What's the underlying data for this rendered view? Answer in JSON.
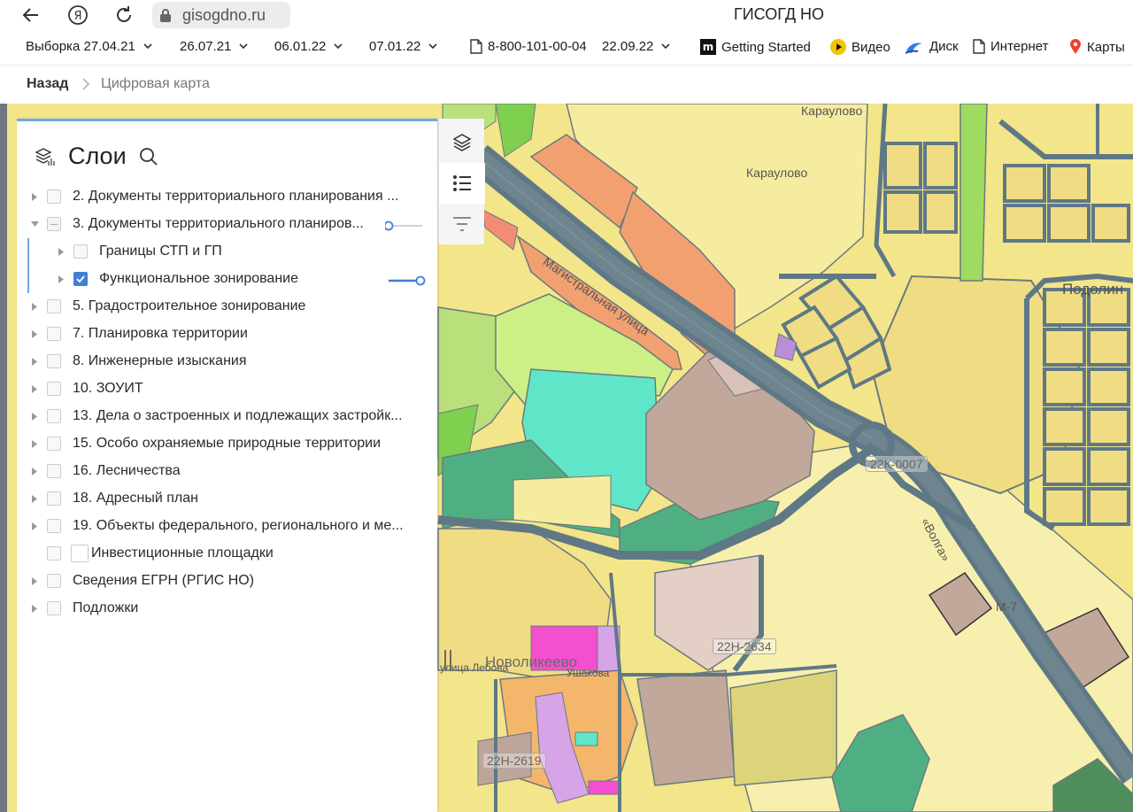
{
  "browser": {
    "url": "gisogdno.ru",
    "title": "ГИСОГД НО"
  },
  "bookmarks": [
    {
      "label": "Выборка 27.04.21",
      "dropdown": true
    },
    {
      "label": "26.07.21",
      "dropdown": true
    },
    {
      "label": "06.01.22",
      "dropdown": true
    },
    {
      "label": "07.01.22",
      "dropdown": true
    },
    {
      "label": "8-800-101-00-04",
      "icon": "document-icon"
    },
    {
      "label": "22.09.22",
      "dropdown": true
    },
    {
      "label": "Getting Started",
      "icon": "m-logo-icon"
    },
    {
      "label": "Видео",
      "icon": "play-icon"
    },
    {
      "label": "Диск",
      "icon": "cloud-icon"
    },
    {
      "label": "Интернет",
      "icon": "document-icon"
    },
    {
      "label": "Карты",
      "icon": "map-pin-icon"
    }
  ],
  "breadcrumb": {
    "back": "Назад",
    "current": "Цифровая карта"
  },
  "panel": {
    "title": "Слои"
  },
  "layers": [
    {
      "label": "2. Документы территориального планирования ...",
      "level": 0,
      "state": "unchecked",
      "expandable": true
    },
    {
      "label": "3. Документы территориального планиров...",
      "level": 0,
      "state": "indeterminate",
      "expandable": true,
      "expanded": true,
      "opacity": 0.0
    },
    {
      "label": "Границы СТП и ГП",
      "level": 1,
      "state": "unchecked",
      "expandable": true
    },
    {
      "label": "Функциональное зонирование",
      "level": 1,
      "state": "checked",
      "expandable": true,
      "opacity": 1.0
    },
    {
      "label": "5. Градостроительное зонирование",
      "level": 0,
      "state": "unchecked",
      "expandable": true
    },
    {
      "label": "7. Планировка территории",
      "level": 0,
      "state": "unchecked",
      "expandable": true
    },
    {
      "label": "8. Инженерные изыскания",
      "level": 0,
      "state": "unchecked",
      "expandable": true
    },
    {
      "label": "10. ЗОУИТ",
      "level": 0,
      "state": "unchecked",
      "expandable": true
    },
    {
      "label": "13. Дела о застроенных и подлежащих застройк...",
      "level": 0,
      "state": "unchecked",
      "expandable": true
    },
    {
      "label": "15. Особо охраняемые природные территории",
      "level": 0,
      "state": "unchecked",
      "expandable": true
    },
    {
      "label": "16. Лесничества",
      "level": 0,
      "state": "unchecked",
      "expandable": true
    },
    {
      "label": "18. Адресный план",
      "level": 0,
      "state": "unchecked",
      "expandable": true
    },
    {
      "label": "19. Объекты федерального, регионального и ме...",
      "level": 0,
      "state": "unchecked",
      "expandable": true
    },
    {
      "label": "Инвестиционные площадки",
      "level": 0,
      "state": "unchecked",
      "expandable": false
    },
    {
      "label": "Сведения ЕГРН (РГИС НО)",
      "level": 0,
      "state": "unchecked",
      "expandable": true
    },
    {
      "label": "Подложки",
      "level": 0,
      "state": "unchecked",
      "expandable": true
    }
  ],
  "map": {
    "labels": [
      "Караулово",
      "Караулово",
      "Магистральная улица",
      "Подолин",
      "«Волга»",
      "М-7",
      "Новоликеево",
      "Ушакова",
      "улица Лебова"
    ],
    "road_badges": [
      "22К-0007",
      "22Н-2634",
      "22Н-2619"
    ]
  },
  "colors": {
    "accent": "#3f7fd6",
    "panel_top": "#6aa8e6",
    "residential": "#f3e58a",
    "industrial": "#f3a070",
    "green": "#b9e07a",
    "water": "#59e6c6",
    "public": "#c9a9a0",
    "road": "#5f7885"
  }
}
